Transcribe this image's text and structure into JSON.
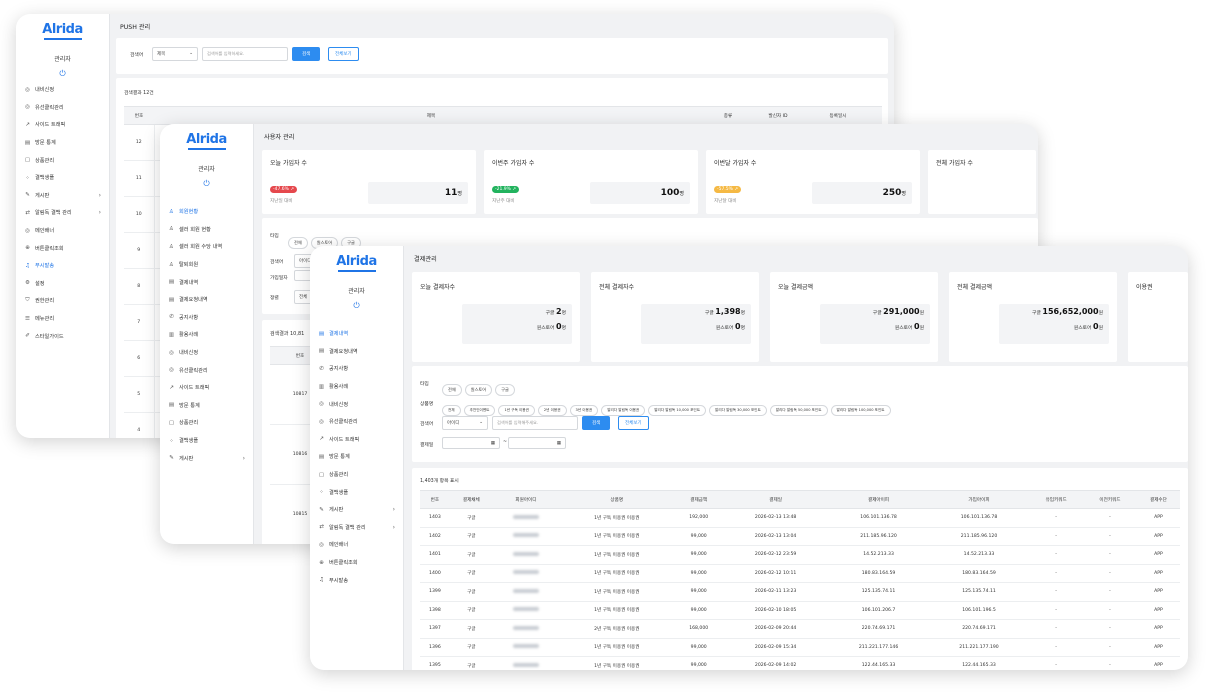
{
  "w1": {
    "logo": "Alrida",
    "admin": "관리자",
    "power": "⏻",
    "title": "PUSH 관리",
    "menu": [
      {
        "label": "내비신정",
        "icon": "pin-icon",
        "glyph": "◎"
      },
      {
        "label": "유선클릭관리",
        "icon": "pin-icon",
        "glyph": "◎"
      },
      {
        "label": "사이드 트래픽",
        "icon": "trend-icon",
        "glyph": "↗"
      },
      {
        "label": "방문 통계",
        "icon": "doc-icon",
        "glyph": "▤"
      },
      {
        "label": "상품관리",
        "icon": "bag-icon",
        "glyph": "▢"
      },
      {
        "label": "결백생플",
        "icon": "grid-icon",
        "glyph": "⁘"
      },
      {
        "label": "게시판",
        "icon": "edit-icon",
        "glyph": "✎",
        "arrow": "›"
      },
      {
        "label": "알림독 결백 관리",
        "icon": "swap-icon",
        "glyph": "⇄",
        "arrow": "›"
      },
      {
        "label": "메인배너",
        "icon": "target-icon",
        "glyph": "◎"
      },
      {
        "label": "버튼클릭조회",
        "icon": "link-icon",
        "glyph": "⊕"
      },
      {
        "label": "푸시발송",
        "icon": "bell-icon",
        "glyph": "♫",
        "on": true
      },
      {
        "label": "설정",
        "icon": "gear-icon",
        "glyph": "⚙"
      },
      {
        "label": "권한관리",
        "icon": "shield-icon",
        "glyph": "⛉"
      },
      {
        "label": "메뉴관리",
        "icon": "menu-icon",
        "glyph": "☰"
      },
      {
        "label": "스타일가이드",
        "icon": "style-icon",
        "glyph": "✐"
      }
    ],
    "search": {
      "label": "검색어",
      "select": "제목",
      "placeholder": "검색어를 입력하세요.",
      "btn": "검색",
      "all": "전체보기"
    },
    "result": "검색결과 12건",
    "headers": [
      "번호",
      "제목",
      "종류",
      "발신자 ID",
      "등록일시"
    ],
    "rows": [
      "12",
      "11",
      "10",
      "9",
      "8",
      "7",
      "6",
      "5",
      "4"
    ]
  },
  "w2": {
    "logo": "Alrida",
    "admin": "관리자",
    "power": "⏻",
    "title": "사용자 관리",
    "menu": [
      {
        "label": "회원현황",
        "icon": "user-icon",
        "glyph": "♙",
        "on": true
      },
      {
        "label": "셀러 회원 현황",
        "icon": "user-icon",
        "glyph": "♙"
      },
      {
        "label": "셀러 회원 수당 내역",
        "icon": "user-icon",
        "glyph": "♙"
      },
      {
        "label": "탈퇴회원",
        "icon": "user-x-icon",
        "glyph": "♙"
      },
      {
        "label": "결제내역",
        "icon": "card-icon",
        "glyph": "▤"
      },
      {
        "label": "결제요청내역",
        "icon": "card-icon",
        "glyph": "▤"
      },
      {
        "label": "공지사항",
        "icon": "megaphone-icon",
        "glyph": "✆"
      },
      {
        "label": "활용사례",
        "icon": "book-icon",
        "glyph": "▥"
      },
      {
        "label": "내비신정",
        "icon": "pin-icon",
        "glyph": "◎"
      },
      {
        "label": "유선클릭관리",
        "icon": "pin-icon",
        "glyph": "◎"
      },
      {
        "label": "사이드 트래픽",
        "icon": "trend-icon",
        "glyph": "↗"
      },
      {
        "label": "방문 통계",
        "icon": "doc-icon",
        "glyph": "▤"
      },
      {
        "label": "상품관리",
        "icon": "bag-icon",
        "glyph": "▢"
      },
      {
        "label": "결백생플",
        "icon": "grid-icon",
        "glyph": "⁘"
      },
      {
        "label": "게시판",
        "icon": "edit-icon",
        "glyph": "✎",
        "arrow": "›"
      }
    ],
    "stats": [
      {
        "title": "오늘 가입자 수",
        "badge": "-47.6% ↗",
        "color": "#e5484d",
        "sub": "지난일 대비",
        "value": "11",
        "unit": "명"
      },
      {
        "title": "이번주 가입자 수",
        "badge": "-21.9% ↗",
        "color": "#22b35e",
        "sub": "지난주 대비",
        "value": "100",
        "unit": "명"
      },
      {
        "title": "이번달 가입자 수",
        "badge": "-57.5% ↗",
        "color": "#f5b944",
        "sub": "지난달 대비",
        "value": "250",
        "unit": "명"
      },
      {
        "title": "전체 가입자 수"
      }
    ],
    "filter": {
      "type_label": "타입",
      "types": [
        "전체",
        "원스토어",
        "구글"
      ],
      "search_label": "검색어",
      "search_select": "아이디",
      "date_label": "가입일자",
      "status_label": "정렬",
      "status_select": "전체"
    },
    "result": "검색결과 10,81",
    "headers": [
      "번호"
    ],
    "rows": [
      "10817",
      "10816",
      "10815"
    ]
  },
  "w3": {
    "logo": "Alrida",
    "admin": "관리자",
    "power": "⏻",
    "title": "결제관리",
    "menu": [
      {
        "label": "결제내역",
        "icon": "card-icon",
        "glyph": "▤",
        "on": true
      },
      {
        "label": "결제요청내역",
        "icon": "card-icon",
        "glyph": "▤"
      },
      {
        "label": "공지사항",
        "icon": "megaphone-icon",
        "glyph": "✆"
      },
      {
        "label": "활용사례",
        "icon": "book-icon",
        "glyph": "▥"
      },
      {
        "label": "내비신정",
        "icon": "pin-icon",
        "glyph": "◎"
      },
      {
        "label": "유선클릭관리",
        "icon": "pin-icon",
        "glyph": "◎"
      },
      {
        "label": "사이드 트래픽",
        "icon": "trend-icon",
        "glyph": "↗"
      },
      {
        "label": "방문 통계",
        "icon": "doc-icon",
        "glyph": "▤"
      },
      {
        "label": "상품관리",
        "icon": "bag-icon",
        "glyph": "▢"
      },
      {
        "label": "결백생플",
        "icon": "grid-icon",
        "glyph": "⁘"
      },
      {
        "label": "게시판",
        "icon": "edit-icon",
        "glyph": "✎",
        "arrow": "›"
      },
      {
        "label": "알림독 결백 관리",
        "icon": "swap-icon",
        "glyph": "⇄",
        "arrow": "›"
      },
      {
        "label": "메인배너",
        "icon": "target-icon",
        "glyph": "◎"
      },
      {
        "label": "버튼클릭조회",
        "icon": "link-icon",
        "glyph": "⊕"
      },
      {
        "label": "푸시발송",
        "icon": "bell-icon",
        "glyph": "♫"
      }
    ],
    "stats": [
      {
        "title": "오늘 결제자수",
        "g": "구글",
        "gv": "2",
        "gu": "명",
        "o": "원스토어",
        "ov": "0",
        "ou": "명"
      },
      {
        "title": "전체 결제자수",
        "g": "구글",
        "gv": "1,398",
        "gu": "명",
        "o": "원스토어",
        "ov": "0",
        "ou": "명"
      },
      {
        "title": "오늘 결제금액",
        "g": "구글",
        "gv": "291,000",
        "gu": "원",
        "o": "원스토어",
        "ov": "0",
        "ou": "원"
      },
      {
        "title": "전체 결제금액",
        "g": "구글",
        "gv": "156,652,000",
        "gu": "원",
        "o": "원스토어",
        "ov": "0",
        "ou": "원"
      },
      {
        "title": "이용권"
      }
    ],
    "filter": {
      "type_label": "타입",
      "types": [
        "전체",
        "원스토어",
        "구글"
      ],
      "product_label": "상품명",
      "products": [
        "전체",
        "추천인이벤트",
        "1년 구독 이용권",
        "2년 이용권",
        "3년 이용권",
        "알리다 알림독 이용권",
        "알리다 알림독 10,000 포인트",
        "알리다 알림독 30,000 포인트",
        "알리다 알림독 50,000 포인트",
        "알리다 알림독 100,000 포인트"
      ],
      "search_label": "검색어",
      "search_select": "아이디",
      "placeholder": "검색어를 입력해주세요.",
      "btn": "검색",
      "all": "전체보기",
      "date_label": "결제일",
      "date_sep": "~"
    },
    "result": "1,403개 항목 표시",
    "headers": [
      "번호",
      "결제채체",
      "회원아이디",
      "상품명",
      "결제금액",
      "결제일",
      "결제아이피",
      "가입아이피",
      "유입키워드",
      "이전키워드",
      "결제수단"
    ],
    "rows": [
      [
        "1403",
        "구글",
        "1년 구독 이용권 이용권",
        "192,000",
        "2026-02-13 13:48",
        "106.101.136.78",
        "106.101.136.78",
        "-",
        "-",
        "APP"
      ],
      [
        "1402",
        "구글",
        "1년 구독 이용권 이용권",
        "99,000",
        "2026-02-13 13:04",
        "211.185.96.120",
        "211.185.96.120",
        "-",
        "-",
        "APP"
      ],
      [
        "1401",
        "구글",
        "1년 구독 이용권 이용권",
        "99,000",
        "2026-02-12 23:59",
        "14.52.213.33",
        "14.52.213.33",
        "-",
        "-",
        "APP"
      ],
      [
        "1400",
        "구글",
        "1년 구독 이용권 이용권",
        "99,000",
        "2026-02-12 10:11",
        "180.83.164.59",
        "180.83.164.59",
        "-",
        "-",
        "APP"
      ],
      [
        "1399",
        "구글",
        "1년 구독 이용권 이용권",
        "99,000",
        "2026-02-11 13:23",
        "125.135.74.11",
        "125.135.74.11",
        "-",
        "-",
        "APP"
      ],
      [
        "1398",
        "구글",
        "1년 구독 이용권 이용권",
        "99,000",
        "2026-02-10 18:05",
        "106.101.206.7",
        "106.101.196.5",
        "-",
        "-",
        "APP"
      ],
      [
        "1397",
        "구글",
        "2년 구독 이용권 이용권",
        "168,000",
        "2026-02-09 20:44",
        "220.74.69.171",
        "220.74.69.171",
        "-",
        "-",
        "APP"
      ],
      [
        "1396",
        "구글",
        "1년 구독 이용권 이용권",
        "99,000",
        "2026-02-09 15:34",
        "211.221.177.146",
        "211.221.177.190",
        "-",
        "-",
        "APP"
      ],
      [
        "1395",
        "구글",
        "1년 구독 이용권 이용권",
        "99,000",
        "2026-02-09 14:02",
        "122.44.165.33",
        "122.44.165.33",
        "-",
        "-",
        "APP"
      ]
    ]
  }
}
